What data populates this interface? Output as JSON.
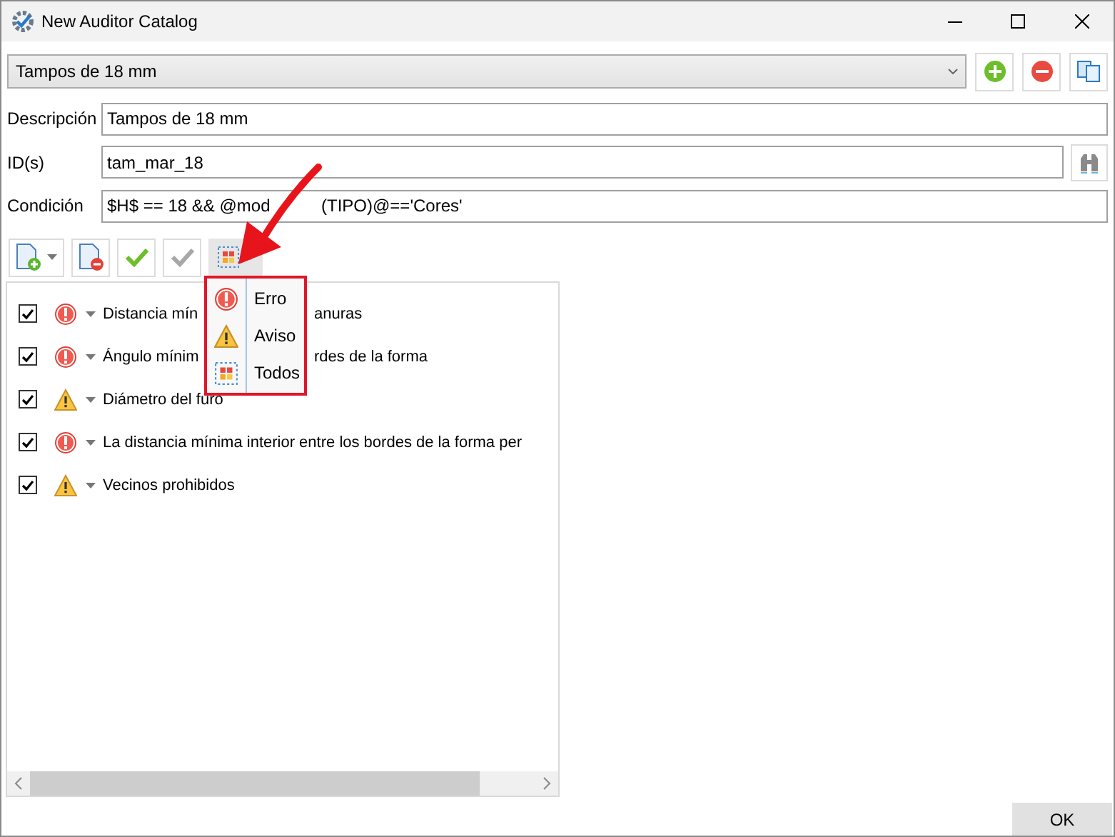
{
  "window": {
    "title": "New Auditor Catalog"
  },
  "catalog_select": {
    "value": "Tampos de 18 mm"
  },
  "description": {
    "label": "Descripción",
    "value": "Tampos de 18 mm"
  },
  "ids": {
    "label": "ID(s)",
    "value": "tam_mar_18"
  },
  "condition": {
    "label": "Condición",
    "value_parts": [
      "$H$ == 18 && @mod",
      "(TIPO)@=='Cores'"
    ]
  },
  "rules": [
    {
      "checked": true,
      "kind": "error",
      "label_parts": [
        "Distancia mín",
        "anuras"
      ]
    },
    {
      "checked": true,
      "kind": "error",
      "label_parts": [
        "Ángulo mínim",
        "rdes de la forma"
      ]
    },
    {
      "checked": true,
      "kind": "warning",
      "label_parts": [
        "Diámetro del furo"
      ]
    },
    {
      "checked": true,
      "kind": "error",
      "label_parts": [
        "La distancia mínima interior entre los bordes de la forma per"
      ]
    },
    {
      "checked": true,
      "kind": "warning",
      "label_parts": [
        "Vecinos prohibidos"
      ]
    }
  ],
  "filter_menu": [
    {
      "kind": "error",
      "label": "Erro"
    },
    {
      "kind": "warning",
      "label": "Aviso"
    },
    {
      "kind": "all",
      "label": "Todos"
    }
  ],
  "ok_button": "OK"
}
